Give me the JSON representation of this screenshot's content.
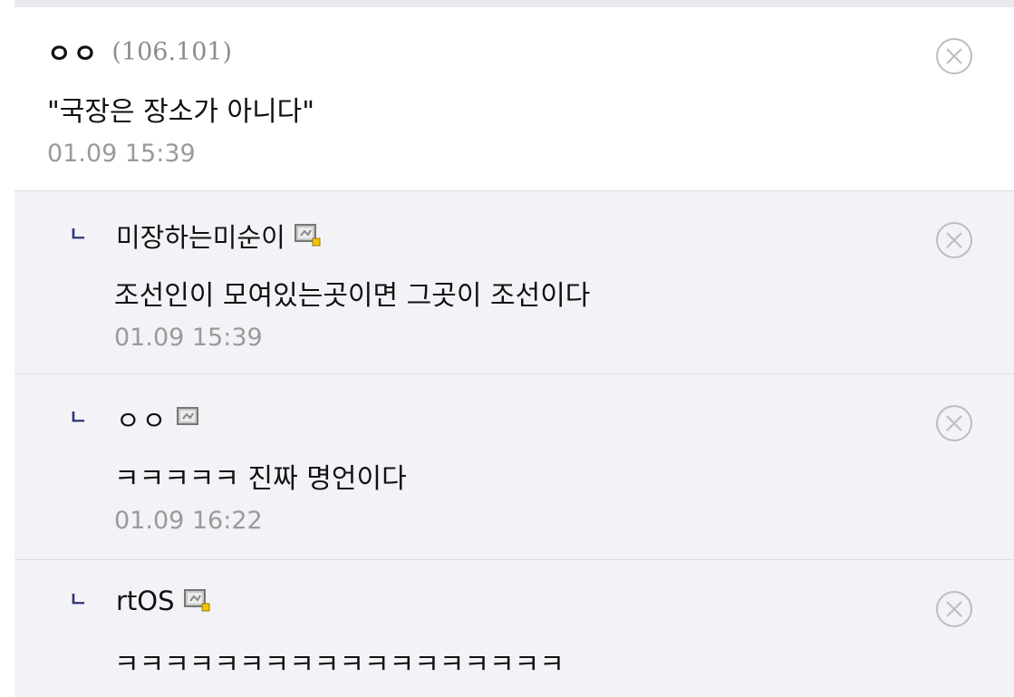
{
  "comments": [
    {
      "nick": "ㅇㅇ",
      "ip": "(106.101)",
      "text": "\"국장은 장소가 아니다\"",
      "time": "01.09 15:39"
    }
  ],
  "replies": [
    {
      "marker": "ㄴ",
      "nick": "미장하는미순이",
      "icon": "gallery-member-icon-yellow",
      "text": "조선인이 모여있는곳이면 그곳이 조선이다",
      "time": "01.09 15:39"
    },
    {
      "marker": "ㄴ",
      "nick": "ㅇㅇ",
      "icon": "gallery-member-icon",
      "text": "ㅋㅋㅋㅋㅋ 진짜 명언이다",
      "time": "01.09 16:22"
    },
    {
      "marker": "ㄴ",
      "nick": "rtOS",
      "icon": "gallery-member-icon-yellow",
      "text": "ㅋㅋㅋㅋㅋㅋㅋㅋㅋㅋㅋㅋㅋㅋㅋㅋㅋㅋ"
    }
  ],
  "colors": {
    "reply_bg": "#f3f3f7",
    "reply_marker": "#2e3577",
    "meta_text": "#9a9a9a"
  }
}
